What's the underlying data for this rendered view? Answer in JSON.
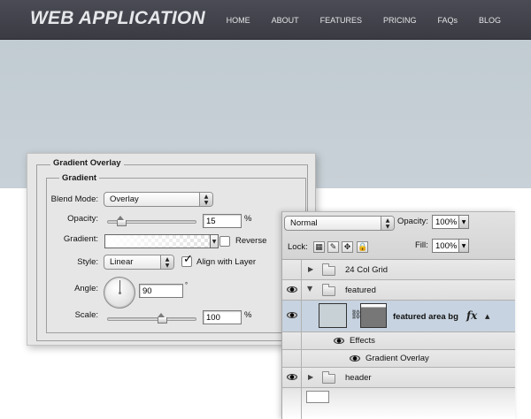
{
  "site": {
    "logo": "WEB APPLICATION",
    "nav": [
      "HOME",
      "ABOUT",
      "FEATURES",
      "PRICING",
      "FAQs",
      "BLOG"
    ]
  },
  "layer_style": {
    "section_title": "Gradient Overlay",
    "group_title": "Gradient",
    "blend_mode_label": "Blend Mode:",
    "blend_mode_value": "Overlay",
    "opacity_label": "Opacity:",
    "opacity_value": "15",
    "opacity_unit": "%",
    "gradient_label": "Gradient:",
    "reverse_label": "Reverse",
    "reverse_checked": false,
    "style_label": "Style:",
    "style_value": "Linear",
    "align_label": "Align with Layer",
    "align_checked": true,
    "angle_label": "Angle:",
    "angle_value": "90",
    "angle_unit": "°",
    "scale_label": "Scale:",
    "scale_value": "100",
    "scale_unit": "%"
  },
  "layers_panel": {
    "blend_mode_value": "Normal",
    "opacity_label": "Opacity:",
    "opacity_value": "100%",
    "lock_label": "Lock:",
    "fill_label": "Fill:",
    "fill_value": "100%",
    "layers": [
      {
        "name": "24 Col Grid",
        "visible": false
      },
      {
        "name": "featured",
        "visible": true
      },
      {
        "name": "featured area bg",
        "visible": true,
        "selected": true
      },
      {
        "name": "Effects"
      },
      {
        "name": "Gradient Overlay"
      },
      {
        "name": "header",
        "visible": true
      }
    ]
  },
  "colors": {
    "header_bg": "#3f4048",
    "hero_bg": "#c4ced4",
    "selected_layer": "#c7d3e0"
  }
}
